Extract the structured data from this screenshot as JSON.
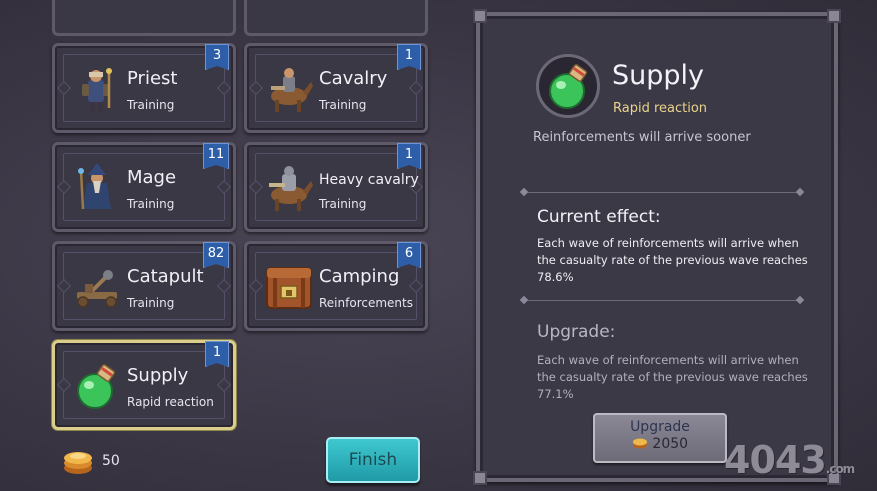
{
  "units": [
    {
      "name": "Priest",
      "sub": "Training",
      "count": "3",
      "art": "priest-icon"
    },
    {
      "name": "Cavalry",
      "sub": "Training",
      "count": "1",
      "art": "cavalry-icon"
    },
    {
      "name": "Mage",
      "sub": "Training",
      "count": "11",
      "art": "mage-icon"
    },
    {
      "name": "Heavy cavalry",
      "sub": "Training",
      "count": "1",
      "art": "heavy-cavalry-icon"
    },
    {
      "name": "Catapult",
      "sub": "Training",
      "count": "82",
      "art": "catapult-icon"
    },
    {
      "name": "Camping",
      "sub": "Reinforcements",
      "count": "6",
      "art": "camping-chest-icon"
    },
    {
      "name": "Supply",
      "sub": "Rapid reaction",
      "count": "1",
      "art": "potion-icon"
    }
  ],
  "gold": {
    "amount": "50",
    "icon": "coin-stack-icon"
  },
  "finish_label": "Finish",
  "detail": {
    "title": "Supply",
    "subtitle": "Rapid reaction",
    "description": "Reinforcements will arrive sooner",
    "current_heading": "Current effect:",
    "current_text": "Each wave of reinforcements will arrive when the casualty rate of the previous wave reaches 78.6%",
    "upgrade_heading": "Upgrade:",
    "upgrade_text": "Each wave of reinforcements will arrive when the casualty rate of the previous wave reaches 77.1%",
    "upgrade_button": "Upgrade",
    "upgrade_cost": "2050"
  },
  "watermark": {
    "main": "4043",
    "suffix": ".com"
  },
  "colors": {
    "accent_blue": "#2f5ea8",
    "selected_border": "#d9cf8a",
    "finish": "#2fb4bd",
    "subtitle_yellow": "#e9d38a"
  }
}
